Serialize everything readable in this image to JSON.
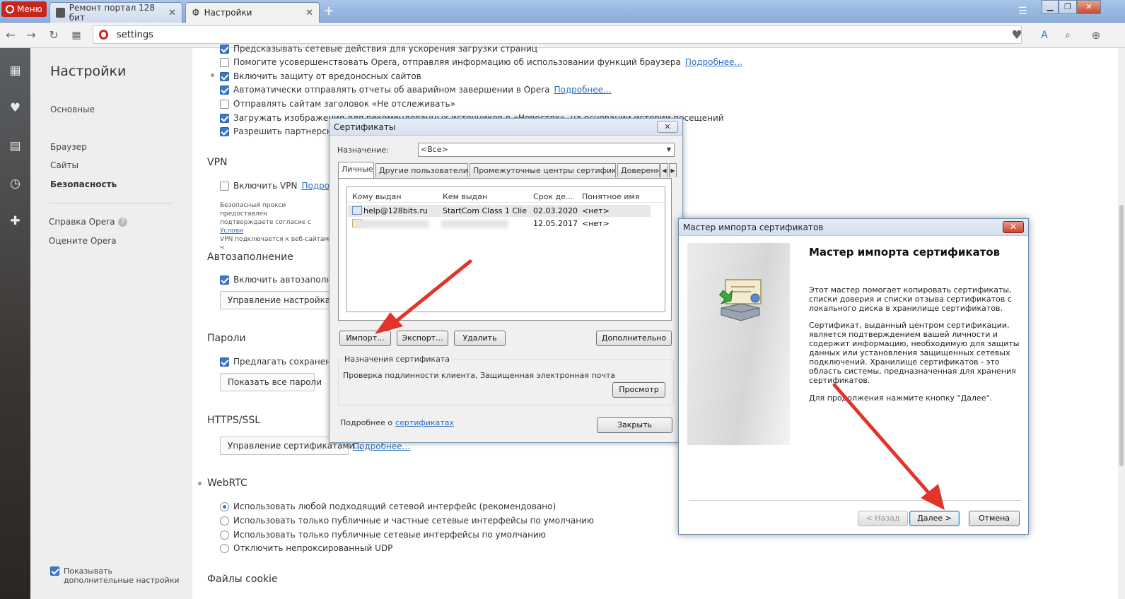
{
  "browser": {
    "menu_label": "Меню",
    "tabs": [
      {
        "label": "Ремонт портал 128 бит",
        "active": false
      },
      {
        "label": "Настройки",
        "active": true
      }
    ],
    "new_tab_symbol": "+",
    "address": "settings",
    "accent_color": "#d3261e"
  },
  "settings_nav": {
    "title": "Настройки",
    "items": [
      "Основные",
      "Браузер",
      "Сайты",
      "Безопасность"
    ],
    "bottom_items": [
      "Справка Opera",
      "Оцените Opera"
    ],
    "show_advanced": "Показывать дополнительные настройки"
  },
  "main": {
    "privacy_rows": [
      {
        "label": "Предсказывать сетевые действия для ускорения загрузки страниц",
        "checked": true
      },
      {
        "label": "Помогите усовершенствовать Opera, отправляя информацию об использовании функций браузера",
        "checked": false,
        "link": "Подробнее..."
      },
      {
        "label": "Включить защиту от вредоносных сайтов",
        "checked": true
      },
      {
        "label": "Автоматически отправлять отчеты об аварийном завершении в Opera",
        "checked": true,
        "link": "Подробнее..."
      },
      {
        "label": "Отправлять сайтам заголовок «Не отслеживать»",
        "checked": false
      },
      {
        "label": "Загружать изображения для рекомендованных источников в «Новостях», на основании истории посещений",
        "checked": true
      },
      {
        "label": "Разрешить партнерским",
        "checked": true
      }
    ],
    "vpn": {
      "heading": "VPN",
      "row": "Включить VPN",
      "row_link": "Подробне",
      "note1": "Безопасный прокси предоставлен",
      "note2": "подтверждаете согласие с",
      "note2_link": "Услови",
      "note3": "VPN подключается к веб-сайтам ч"
    },
    "autofill": {
      "heading": "Автозаполнение",
      "row": "Включить автозаполнени",
      "button": "Управление настройками"
    },
    "passwords": {
      "heading": "Пароли",
      "row": "Предлагать сохранение в",
      "button": "Показать все пароли"
    },
    "https": {
      "heading": "HTTPS/SSL",
      "button": "Управление сертификатами...",
      "link": "Подробнее..."
    },
    "webrtc": {
      "heading": "WebRTC",
      "options": [
        {
          "label": "Использовать любой подходящий сетевой интерфейс (рекомендовано)",
          "selected": true
        },
        {
          "label": "Использовать только публичные и частные сетевые интерфейсы по умолчанию",
          "selected": false
        },
        {
          "label": "Использовать только публичные сетевые интерфейсы по умолчанию",
          "selected": false
        },
        {
          "label": "Отключить непроксированный UDP",
          "selected": false
        }
      ]
    },
    "cookies_heading": "Файлы cookie"
  },
  "cert_dialog": {
    "title": "Сертификаты",
    "close": "✕",
    "purpose_label": "Назначение:",
    "purpose_value": "<Все>",
    "tabs": [
      "Личные",
      "Другие пользователи",
      "Промежуточные центры сертификации",
      "Доверенны"
    ],
    "columns": [
      "Кому выдан",
      "Кем выдан",
      "Срок де...",
      "Понятное имя"
    ],
    "rows": [
      {
        "to": "help@128bits.ru",
        "by": "StartCom Class 1 Clie...",
        "exp": "02.03.2020",
        "name": "<нет>"
      },
      {
        "to": "",
        "by": "",
        "exp": "12.05.2017",
        "name": "<нет>"
      }
    ],
    "buttons": {
      "import": "Импорт...",
      "export": "Экспорт...",
      "delete": "Удалить",
      "advanced": "Дополнительно",
      "view": "Просмотр",
      "close": "Закрыть"
    },
    "purposes_group": "Назначения сертификата",
    "purposes_text": "Проверка подлинности клиента, Защищенная электронная почта",
    "more_prefix": "Подробнее о",
    "more_link": "сертификатах"
  },
  "wizard": {
    "title": "Мастер импорта сертификатов",
    "close": "✕",
    "heading": "Мастер импорта сертификатов",
    "para1": [
      "Этот мастер помогает копировать сертификаты,",
      "списки доверия и списки отзыва сертификатов с",
      "локального диска в хранилище сертификатов."
    ],
    "para2": [
      "Сертификат, выданный центром сертификации,",
      "является подтверждением вашей личности и",
      "содержит информацию, необходимую для защиты",
      "данных или установления защищенных сетевых",
      "подключений. Хранилище сертификатов - это",
      "область системы, предназначенная для хранения",
      "сертификатов."
    ],
    "para3": "Для продолжения нажмите кнопку \"Далее\".",
    "buttons": {
      "back": "< Назад",
      "next": "Далее >",
      "cancel": "Отмена"
    }
  },
  "annotation_color": "#e2342a"
}
